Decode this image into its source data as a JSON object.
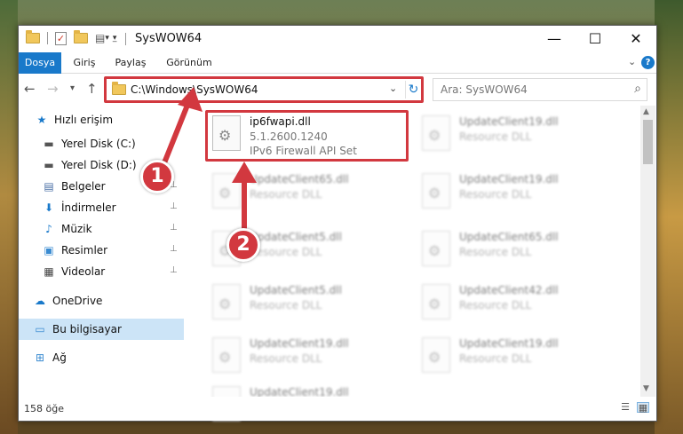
{
  "window": {
    "title": "SysWOW64",
    "minimize": "—",
    "maximize": "☐",
    "close": "✕"
  },
  "ribbon": {
    "tabs": [
      "Dosya",
      "Giriş",
      "Paylaş",
      "Görünüm"
    ],
    "help": "?"
  },
  "nav": {
    "back": "←",
    "forward": "→",
    "recent": "▾",
    "up": "↑",
    "address": "C:\\Windows\\SysWOW64",
    "search_placeholder": "Ara: SysWOW64"
  },
  "sidebar": {
    "items": [
      {
        "label": "Hızlı erişim",
        "icon": "star-icon",
        "glyph": "★",
        "color": "#1979ca"
      },
      {
        "label": "Yerel Disk (C:)",
        "icon": "drive-icon",
        "glyph": "▬",
        "color": "#555555"
      },
      {
        "label": "Yerel Disk (D:)",
        "icon": "drive-icon",
        "glyph": "▬",
        "color": "#555555"
      },
      {
        "label": "Belgeler",
        "icon": "documents-icon",
        "glyph": "▤",
        "color": "#4a6fa5"
      },
      {
        "label": "İndirmeler",
        "icon": "downloads-icon",
        "glyph": "⬇",
        "color": "#1979ca"
      },
      {
        "label": "Müzik",
        "icon": "music-icon",
        "glyph": "♪",
        "color": "#1979ca"
      },
      {
        "label": "Resimler",
        "icon": "pictures-icon",
        "glyph": "▣",
        "color": "#3a8bd1"
      },
      {
        "label": "Videolar",
        "icon": "videos-icon",
        "glyph": "▦",
        "color": "#444444"
      },
      {
        "label": "OneDrive",
        "icon": "onedrive-icon",
        "glyph": "☁",
        "color": "#1979ca"
      },
      {
        "label": "Bu bilgisayar",
        "icon": "computer-icon",
        "glyph": "▭",
        "color": "#3a8bd1"
      },
      {
        "label": "Ağ",
        "icon": "network-icon",
        "glyph": "⊞",
        "color": "#3a8bd1"
      }
    ],
    "pin": "📌"
  },
  "files": [
    {
      "name": "ip6fwapi.dll",
      "line2": "5.1.2600.1240",
      "line3": "IPv6 Firewall API Set"
    },
    {
      "name": "UpdateClient19.dll",
      "line2": "Resource DLL"
    },
    {
      "name": "UpdateClient65.dll",
      "line2": "Resource DLL"
    },
    {
      "name": "UpdateClient19.dll",
      "line2": "Resource DLL"
    },
    {
      "name": "UpdateClient19.dll",
      "line2": "Resource DLL"
    },
    {
      "name": "UpdateClient5.dll",
      "line2": "Resource DLL"
    },
    {
      "name": "UpdateClient65.dll",
      "line2": "Resource DLL"
    },
    {
      "name": "UpdateClient5.dll",
      "line2": "Resource DLL"
    },
    {
      "name": "UpdateClient42.dll",
      "line2": "Resource DLL"
    },
    {
      "name": "UpdateClient19.dll",
      "line2": "Resource DLL"
    },
    {
      "name": "UpdateClient19.dll",
      "line2": "Resource DLL"
    }
  ],
  "status": {
    "count": "158 öğe"
  },
  "annotations": {
    "badge1": "1",
    "badge2": "2",
    "accent": "#d2383f"
  }
}
